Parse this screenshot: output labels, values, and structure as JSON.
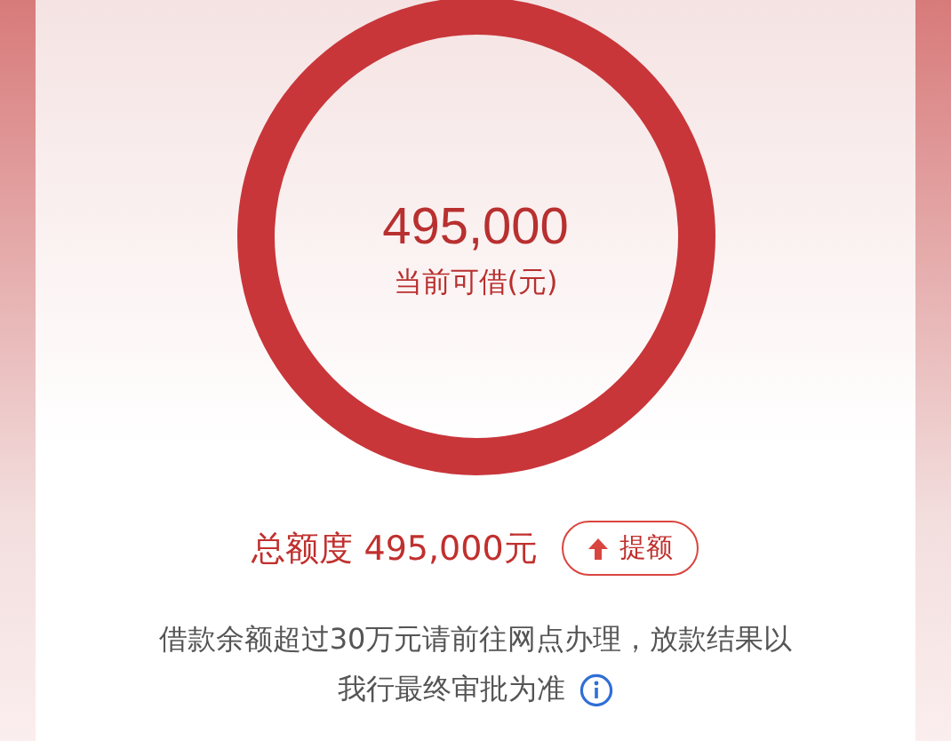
{
  "gauge": {
    "amount": "495,000",
    "caption": "当前可借(元)"
  },
  "total": {
    "label": "总额度 495,000元",
    "button": "提额"
  },
  "notice": {
    "line_1": "借款余额超过30万元请前往网点办理，放款结果以",
    "line_2": "我行最终审批为准"
  }
}
